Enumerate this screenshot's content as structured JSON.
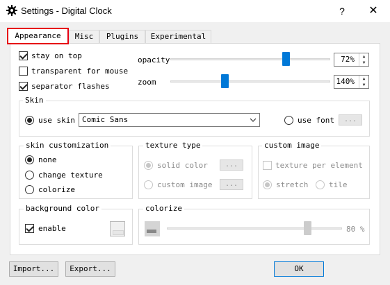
{
  "window": {
    "title": "Settings - Digital Clock",
    "help_label": "?",
    "close_label": "✕"
  },
  "tabs": [
    {
      "label": "Appearance",
      "active": true
    },
    {
      "label": "Misc",
      "active": false
    },
    {
      "label": "Plugins",
      "active": false
    },
    {
      "label": "Experimental",
      "active": false
    }
  ],
  "general": {
    "stay_on_top": {
      "label": "stay on top",
      "checked": true
    },
    "transparent": {
      "label": "transparent for mouse",
      "checked": false
    },
    "separator": {
      "label": "separator flashes",
      "checked": true
    },
    "opacity": {
      "label": "opacity",
      "value": "72%",
      "level": 0.72
    },
    "zoom": {
      "label": "zoom",
      "value": "140%"
    }
  },
  "skin": {
    "title": "Skin",
    "use_skin_label": "use skin",
    "skin_value": "Comic Sans",
    "use_font_label": "use font",
    "font_button": "..."
  },
  "skin_customization": {
    "title": "skin customization",
    "options": [
      "none",
      "change texture",
      "colorize"
    ],
    "selected": "none"
  },
  "texture_type": {
    "title": "texture type",
    "solid_color_label": "solid color",
    "custom_image_label": "custom image",
    "button_label": "..."
  },
  "custom_image": {
    "title": "custom image",
    "texture_per_element_label": "texture per element",
    "stretch_label": "stretch",
    "tile_label": "tile"
  },
  "background_color": {
    "title": "background color",
    "enable_label": "enable",
    "enabled": true
  },
  "colorize": {
    "title": "colorize",
    "value": "80 %",
    "level": 0.8
  },
  "footer": {
    "import_label": "Import...",
    "export_label": "Export...",
    "ok_label": "OK"
  },
  "colors": {
    "accent": "#0078d7",
    "highlight_border": "#e60012",
    "window_bg": "#f0f0f0"
  }
}
